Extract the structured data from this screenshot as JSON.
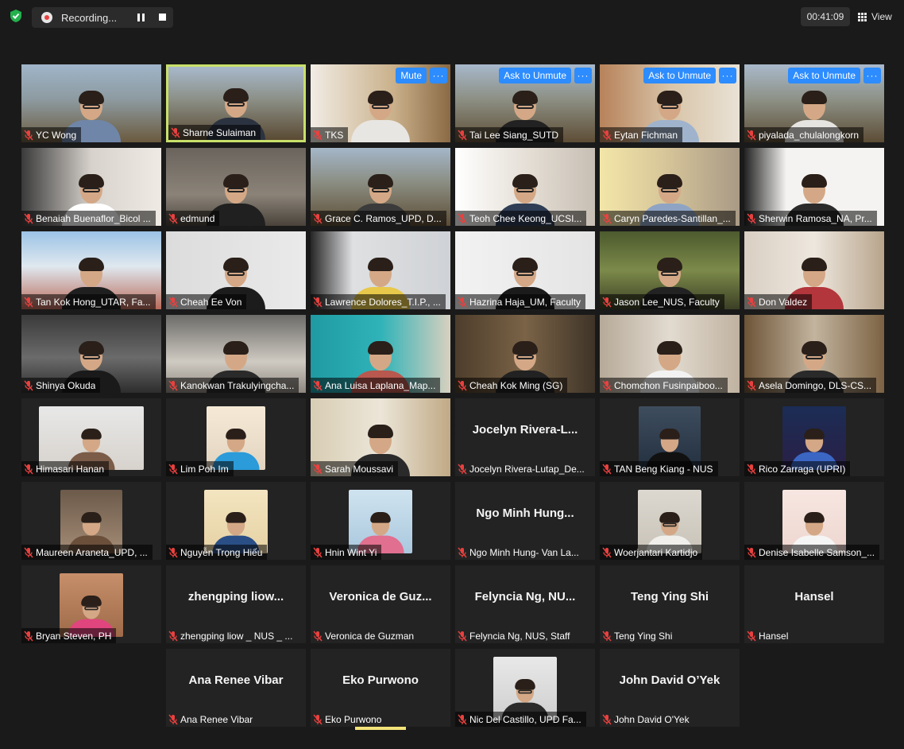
{
  "topbar": {
    "recording_label": "Recording...",
    "timer": "00:41:09",
    "view_label": "View"
  },
  "controls": {
    "mute": "Mute",
    "ask_to_unmute": "Ask to Unmute",
    "more": "···"
  },
  "colors": {
    "background": "#1a1a1a",
    "tile_background": "#232323",
    "active_speaker_border": "#c8e06a",
    "overlay_button": "#2d8cff",
    "muted_icon": "#e8413f",
    "security_shield": "#23b14d"
  },
  "participants": [
    {
      "name": "YC Wong"
    },
    {
      "name": "Sharne Sulaiman"
    },
    {
      "name": "TKS"
    },
    {
      "name": "Tai Lee Siang_SUTD"
    },
    {
      "name": "Eytan Fichman"
    },
    {
      "name": "piyalada_chulalongkorn"
    },
    {
      "name": "Benaiah Buenaflor_Bicol ..."
    },
    {
      "name": "edmund"
    },
    {
      "name": "Grace C. Ramos_UPD, D..."
    },
    {
      "name": "Teoh Chee Keong_UCSI..."
    },
    {
      "name": "Caryn Paredes-Santillan_..."
    },
    {
      "name": "Sherwin Ramosa_NA, Pr..."
    },
    {
      "name": "Tan Kok Hong_UTAR, Fa..."
    },
    {
      "name": "Cheah Ee Von"
    },
    {
      "name": "Lawrence Dolores_T.I.P., ..."
    },
    {
      "name": "Hazrina Haja_UM, Faculty"
    },
    {
      "name": "Jason Lee_NUS, Faculty"
    },
    {
      "name": "Don Valdez"
    },
    {
      "name": "Shinya Okuda"
    },
    {
      "name": "Kanokwan Trakulyingcha..."
    },
    {
      "name": "Ana Luisa Laplana_Map..."
    },
    {
      "name": "Cheah Kok Ming (SG)"
    },
    {
      "name": "Chomchon Fusinpaiboo..."
    },
    {
      "name": "Asela Domingo, DLS-CS..."
    },
    {
      "name": "Himasari Hanan"
    },
    {
      "name": "Lim Poh Im"
    },
    {
      "name": "Sarah Moussavi"
    },
    {
      "name": "Jocelyn Rivera-Lutap_De...",
      "big": "Jocelyn Rivera-L..."
    },
    {
      "name": "TAN Beng Kiang - NUS"
    },
    {
      "name": "Rico Zarraga (UPRI)"
    },
    {
      "name": "Maureen Araneta_UPD, ..."
    },
    {
      "name": "Nguyễn Trọng Hiếu"
    },
    {
      "name": "Hnin Wint Yi"
    },
    {
      "name": "Ngo Minh Hung- Van La...",
      "big": "Ngo Minh Hung..."
    },
    {
      "name": "Woerjantari Kartidjo"
    },
    {
      "name": "Denise Isabelle Samson_..."
    },
    {
      "name": "Bryan Steven, PH"
    },
    {
      "name": "zhengping liow _ NUS _ ...",
      "big": "zhengping liow..."
    },
    {
      "name": "Veronica de Guzman",
      "big": "Veronica de Guz..."
    },
    {
      "name": "Felyncia Ng, NUS, Staff",
      "big": "Felyncia Ng, NU..."
    },
    {
      "name": "Teng Ying Shi",
      "big": "Teng Ying Shi"
    },
    {
      "name": "Hansel",
      "big": "Hansel"
    },
    {
      "name": "Ana Renee Vibar",
      "big": "Ana Renee Vibar"
    },
    {
      "name": "Eko Purwono",
      "big": "Eko Purwono"
    },
    {
      "name": "Nic Del Castillo, UPD Fa..."
    },
    {
      "name": "John David O'Yek",
      "big": "John David O’Yek"
    }
  ]
}
